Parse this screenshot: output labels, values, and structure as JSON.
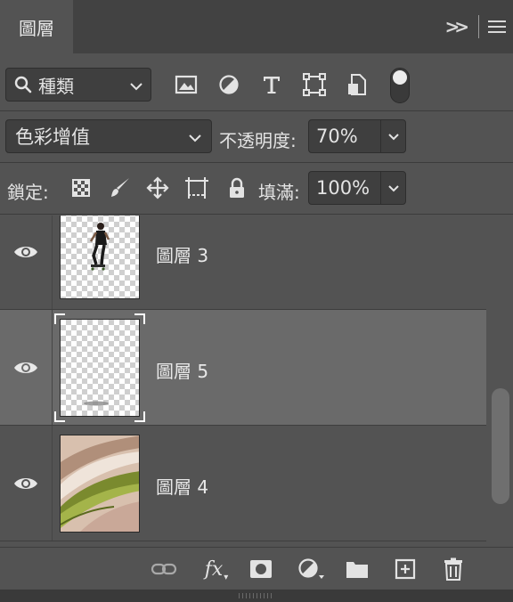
{
  "panel": {
    "tab_title": "圖層",
    "collapse_label": ">>"
  },
  "filter": {
    "kind_label": "種類",
    "icons": [
      "image-filter-icon",
      "adjustment-filter-icon",
      "type-filter-icon",
      "shape-filter-icon",
      "smart-object-filter-icon"
    ]
  },
  "blend": {
    "mode": "色彩增值",
    "opacity_label": "不透明度:",
    "opacity_value": "70%"
  },
  "lock": {
    "label": "鎖定:",
    "fill_label": "填滿:",
    "fill_value": "100%"
  },
  "layers": [
    {
      "name": "圖層 3",
      "visible": true,
      "selected": false
    },
    {
      "name": "圖層 5",
      "visible": true,
      "selected": true
    },
    {
      "name": "圖層 4",
      "visible": true,
      "selected": false
    }
  ],
  "toolbar": {
    "fx_label": "fx"
  },
  "colors": {
    "panel_bg": "#535353",
    "selected_row": "#6a6a6a",
    "titlebar_bg": "#424242"
  }
}
